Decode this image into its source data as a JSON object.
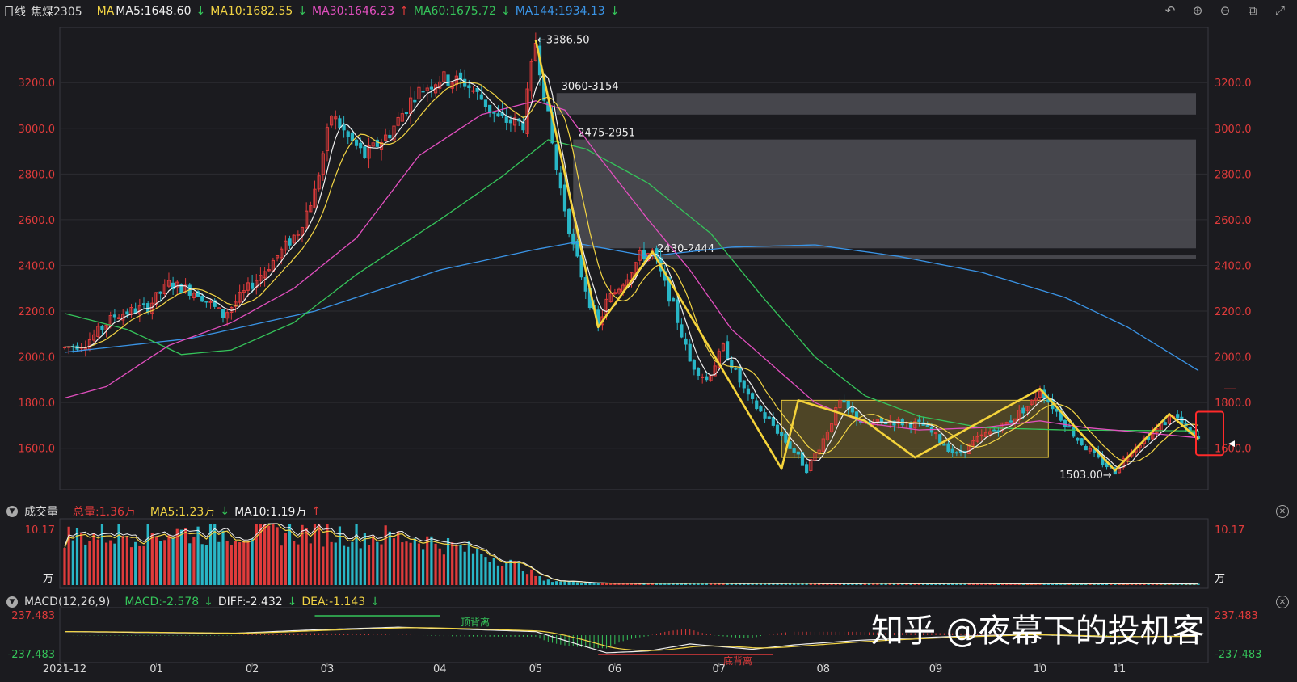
{
  "header": {
    "period": "日线",
    "symbol": "焦煤2305",
    "ma_label": "MA",
    "ma5": "MA5:1648.60",
    "ma10": "MA10:1682.55",
    "ma30": "MA30:1646.23",
    "ma60": "MA60:1675.72",
    "ma144": "MA144:1934.13",
    "arrow_down": "↓",
    "arrow_up": "↑"
  },
  "toolbar": {
    "undo_icon": "↶",
    "zoom_in_icon": "⊕",
    "zoom_out_icon": "⊖",
    "window_icon": "⧉",
    "expand_icon": "⤢"
  },
  "volume_panel": {
    "title": "成交量",
    "total": "总量:1.36万",
    "ma5": "MA5:1.23万",
    "ma10": "MA10:1.19万",
    "top_value": "10.17",
    "unit": "万",
    "collapse_icon": "▼",
    "close_icon": "✕"
  },
  "macd_panel": {
    "title": "MACD(12,26,9)",
    "macd": "MACD:-2.578",
    "diff": "DIFF:-2.432",
    "dea": "DEA:-1.143",
    "top_value": "237.483",
    "bottom_value": "-237.483",
    "top_divergence": "顶背离",
    "bottom_divergence": "底背离"
  },
  "watermark": "知乎 @夜幕下的投机客",
  "colors": {
    "up": "#e03b3b",
    "down": "#29b6c6",
    "ma5": "#f0f0f0",
    "ma10": "#f2d444",
    "ma30": "#e24fbf",
    "ma60": "#35c45a",
    "ma144": "#3a94e6",
    "annotation": "#f5d33a"
  },
  "chart_data": {
    "type": "candlestick",
    "y_axis_ticks": [
      "1600.0",
      "1800.0",
      "2000.0",
      "2200.0",
      "2400.0",
      "2600.0",
      "2800.0",
      "3000.0",
      "3200.0"
    ],
    "ylim": [
      1440,
      3420
    ],
    "x_ticks": [
      {
        "label": "2021-12",
        "d": 0
      },
      {
        "label": "01",
        "d": 22
      },
      {
        "label": "02",
        "d": 45
      },
      {
        "label": "03",
        "d": 63
      },
      {
        "label": "04",
        "d": 90
      },
      {
        "label": "05",
        "d": 113
      },
      {
        "label": "06",
        "d": 132
      },
      {
        "label": "07",
        "d": 157
      },
      {
        "label": "08",
        "d": 182
      },
      {
        "label": "09",
        "d": 209
      },
      {
        "label": "10",
        "d": 234
      },
      {
        "label": "11",
        "d": 253
      }
    ],
    "n_days": 273,
    "price_keypoints": [
      [
        0,
        2040
      ],
      [
        5,
        2060
      ],
      [
        12,
        2180
      ],
      [
        20,
        2220
      ],
      [
        25,
        2320
      ],
      [
        32,
        2280
      ],
      [
        38,
        2180
      ],
      [
        44,
        2300
      ],
      [
        50,
        2420
      ],
      [
        56,
        2550
      ],
      [
        60,
        2720
      ],
      [
        64,
        3060
      ],
      [
        68,
        2960
      ],
      [
        72,
        2880
      ],
      [
        78,
        2980
      ],
      [
        84,
        3150
      ],
      [
        90,
        3220
      ],
      [
        96,
        3200
      ],
      [
        100,
        3130
      ],
      [
        104,
        3040
      ],
      [
        110,
        3020
      ],
      [
        113,
        3380
      ],
      [
        118,
        2820
      ],
      [
        122,
        2480
      ],
      [
        126,
        2240
      ],
      [
        128,
        2130
      ],
      [
        130,
        2240
      ],
      [
        134,
        2330
      ],
      [
        138,
        2440
      ],
      [
        141,
        2460
      ],
      [
        146,
        2220
      ],
      [
        150,
        1980
      ],
      [
        154,
        1900
      ],
      [
        158,
        2040
      ],
      [
        164,
        1820
      ],
      [
        170,
        1700
      ],
      [
        176,
        1560
      ],
      [
        178,
        1510
      ],
      [
        182,
        1640
      ],
      [
        186,
        1800
      ],
      [
        192,
        1700
      ],
      [
        198,
        1720
      ],
      [
        206,
        1700
      ],
      [
        214,
        1570
      ],
      [
        220,
        1650
      ],
      [
        226,
        1710
      ],
      [
        232,
        1800
      ],
      [
        234,
        1860
      ],
      [
        238,
        1760
      ],
      [
        243,
        1640
      ],
      [
        248,
        1550
      ],
      [
        252,
        1500
      ],
      [
        256,
        1600
      ],
      [
        262,
        1680
      ],
      [
        266,
        1750
      ],
      [
        270,
        1660
      ],
      [
        272,
        1640
      ]
    ],
    "ma144_keypoints": [
      [
        0,
        2020
      ],
      [
        30,
        2080
      ],
      [
        60,
        2200
      ],
      [
        90,
        2380
      ],
      [
        113,
        2470
      ],
      [
        122,
        2500
      ],
      [
        140,
        2440
      ],
      [
        160,
        2480
      ],
      [
        180,
        2490
      ],
      [
        200,
        2440
      ],
      [
        220,
        2370
      ],
      [
        240,
        2260
      ],
      [
        255,
        2130
      ],
      [
        272,
        1940
      ]
    ],
    "ma60_keypoints": [
      [
        0,
        2190
      ],
      [
        15,
        2120
      ],
      [
        28,
        2010
      ],
      [
        40,
        2030
      ],
      [
        55,
        2150
      ],
      [
        70,
        2360
      ],
      [
        90,
        2600
      ],
      [
        105,
        2790
      ],
      [
        116,
        2950
      ],
      [
        125,
        2910
      ],
      [
        140,
        2760
      ],
      [
        155,
        2540
      ],
      [
        168,
        2250
      ],
      [
        180,
        2000
      ],
      [
        192,
        1830
      ],
      [
        205,
        1740
      ],
      [
        220,
        1690
      ],
      [
        240,
        1680
      ],
      [
        272,
        1676
      ]
    ],
    "ma30_keypoints": [
      [
        0,
        1820
      ],
      [
        10,
        1870
      ],
      [
        25,
        2050
      ],
      [
        40,
        2150
      ],
      [
        55,
        2300
      ],
      [
        70,
        2520
      ],
      [
        85,
        2880
      ],
      [
        100,
        3060
      ],
      [
        113,
        3120
      ],
      [
        120,
        3080
      ],
      [
        128,
        2880
      ],
      [
        140,
        2600
      ],
      [
        150,
        2380
      ],
      [
        160,
        2120
      ],
      [
        170,
        1960
      ],
      [
        180,
        1800
      ],
      [
        192,
        1710
      ],
      [
        205,
        1680
      ],
      [
        220,
        1690
      ],
      [
        234,
        1720
      ],
      [
        245,
        1690
      ],
      [
        258,
        1670
      ],
      [
        272,
        1646
      ]
    ],
    "vol_keypoints": [
      [
        0,
        0.85
      ],
      [
        30,
        0.9
      ],
      [
        60,
        0.9
      ],
      [
        85,
        0.8
      ],
      [
        100,
        0.55
      ],
      [
        110,
        0.3
      ],
      [
        115,
        0.08
      ],
      [
        130,
        0.03
      ],
      [
        272,
        0.02
      ]
    ],
    "macd_keypoints": [
      [
        0,
        40
      ],
      [
        20,
        30
      ],
      [
        40,
        20
      ],
      [
        60,
        60
      ],
      [
        80,
        90
      ],
      [
        100,
        60
      ],
      [
        113,
        40
      ],
      [
        120,
        -60
      ],
      [
        130,
        -200
      ],
      [
        140,
        -180
      ],
      [
        150,
        -100
      ],
      [
        165,
        -160
      ],
      [
        175,
        -110
      ],
      [
        190,
        -60
      ],
      [
        210,
        -20
      ],
      [
        230,
        10
      ],
      [
        250,
        -20
      ],
      [
        272,
        -10
      ]
    ],
    "zones": [
      {
        "label": "3060-3154",
        "lo": 3060,
        "hi": 3154,
        "from_day": 118
      },
      {
        "label": "2475-2951",
        "lo": 2475,
        "hi": 2951,
        "from_day": 122
      },
      {
        "label": "2430-2444",
        "lo": 2430,
        "hi": 2444,
        "from_day": 141
      }
    ],
    "annotations": [
      {
        "label": "←3386.50",
        "day": 113,
        "price": 3386.5
      },
      {
        "label": "1503.00→",
        "day": 252,
        "price": 1503
      }
    ],
    "range_box": {
      "d0": 172,
      "d1": 236,
      "lo": 1560,
      "hi": 1810
    },
    "zigzag": [
      [
        113,
        3386
      ],
      [
        128,
        2130
      ],
      [
        141,
        2460
      ],
      [
        172,
        1510
      ],
      [
        176,
        1810
      ],
      [
        192,
        1720
      ],
      [
        204,
        1560
      ],
      [
        234,
        1860
      ],
      [
        252,
        1503
      ],
      [
        265,
        1750
      ],
      [
        272,
        1640
      ]
    ]
  }
}
